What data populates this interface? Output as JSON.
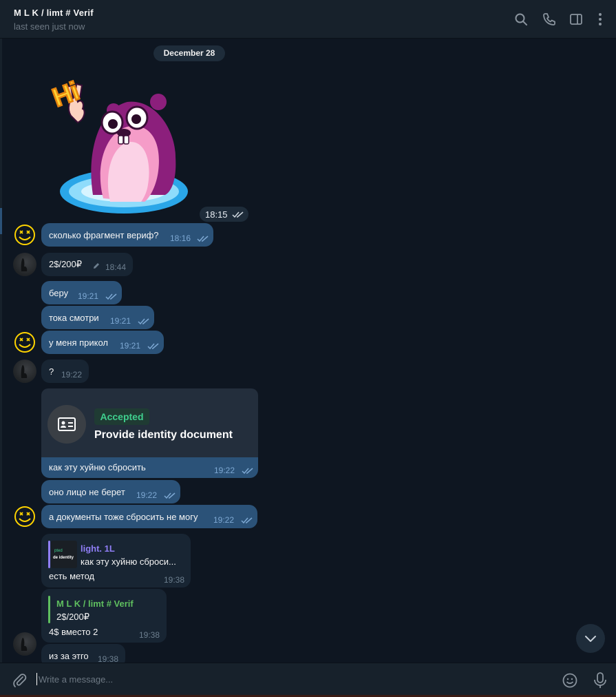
{
  "header": {
    "title": "M L K / limt # Verif",
    "status": "last seen just now",
    "icons": [
      "search-icon",
      "phone-icon",
      "sidebar-toggle-icon",
      "more-icon"
    ]
  },
  "date_separator": "December 28",
  "sticker": {
    "time": "18:15",
    "caption": "Hi"
  },
  "messages": [
    {
      "text": "сколько фрагмент вериф?",
      "time": "18:16",
      "direction": "out"
    },
    {
      "text": "2$/200₽",
      "time": "18:44",
      "direction": "in",
      "edited_icon": "pencil-icon"
    },
    {
      "text": "беру",
      "time": "19:21",
      "direction": "out"
    },
    {
      "text": "тока смотри",
      "time": "19:21",
      "direction": "out"
    },
    {
      "text": "у меня прикол",
      "time": "19:21",
      "direction": "out"
    },
    {
      "text": "?",
      "time": "19:22",
      "direction": "in"
    },
    {
      "text": "как эту хуйню сбросить",
      "time": "19:22",
      "direction": "out"
    },
    {
      "text": "оно лицо не берет",
      "time": "19:22",
      "direction": "out"
    },
    {
      "text": "а документы тоже сбросить не могу",
      "time": "19:22",
      "direction": "out"
    },
    {
      "text": "есть метод",
      "time": "19:38",
      "direction": "in"
    },
    {
      "text": "4$ вместо 2",
      "time": "19:38",
      "direction": "in"
    },
    {
      "text": "из за этго",
      "time": "19:38",
      "direction": "in"
    }
  ],
  "identity_card": {
    "badge": "Accepted",
    "title": "Provide identity document"
  },
  "replies": [
    {
      "author": "light. 1L",
      "quote": "как эту хуйню сброси...",
      "thumb_text_1": "pted",
      "thumb_text_2": "de identity",
      "author_color": "#8f7ef5"
    },
    {
      "author": "M L K / limt # Verif",
      "quote": "2$/200₽",
      "author_color": "#5fbf5f"
    }
  ],
  "composer": {
    "placeholder": "Write a message..."
  },
  "colors": {
    "background": "#0e1621",
    "header": "#17212b",
    "outgoing_bubble": "#2b5278",
    "incoming_bubble": "#182533",
    "accepted_green": "#3fcf8e"
  }
}
